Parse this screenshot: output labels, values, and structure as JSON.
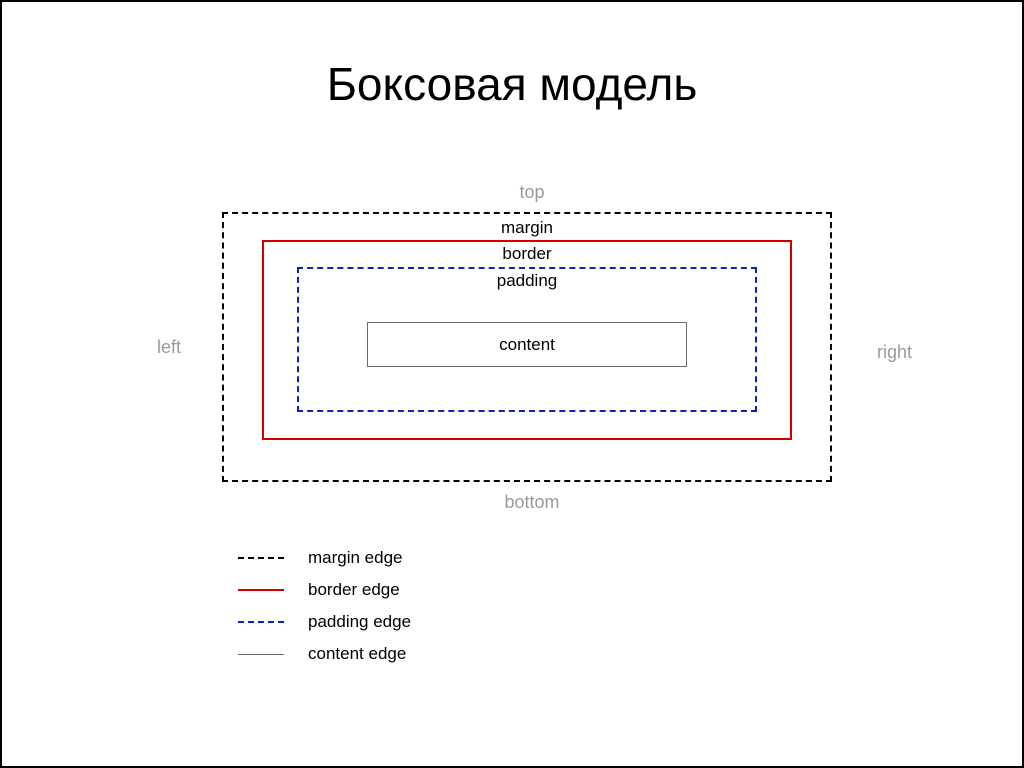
{
  "title": "Боксовая модель",
  "sides": {
    "top": "top",
    "right": "right",
    "bottom": "bottom",
    "left": "left"
  },
  "boxes": {
    "margin": "margin",
    "border": "border",
    "padding": "padding",
    "content": "content"
  },
  "legend": {
    "margin": "margin edge",
    "border": "border edge",
    "padding": "padding edge",
    "content": "content edge"
  }
}
